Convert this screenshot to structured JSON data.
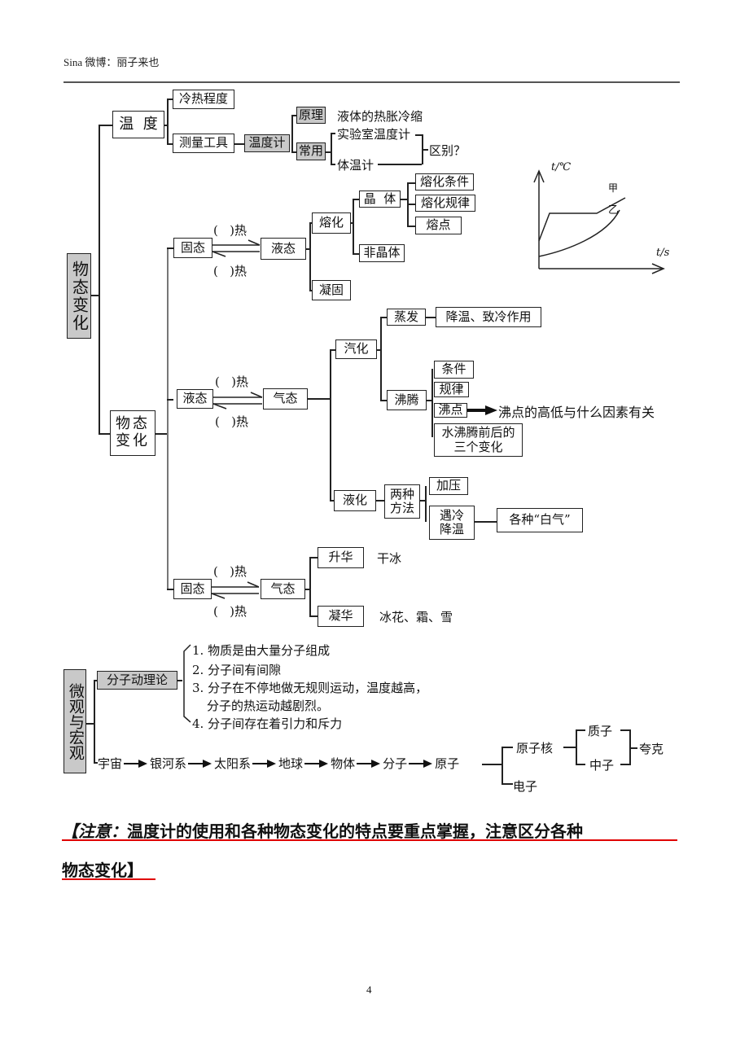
{
  "header": {
    "text": "Sina 微博：丽子来也"
  },
  "root": {
    "wutai_label": "物态变化",
    "weiguan_label": "微观与宏观"
  },
  "temperature": {
    "label": "温  度",
    "meaning": "冷热程度",
    "tool": "测量工具",
    "thermometer": "温度计",
    "principle": "原理",
    "principle_text": "液体的热胀冷缩",
    "common": "常用",
    "lab_thermometer": "实验室温度计",
    "body_thermometer": "体温计",
    "difference": "区别？"
  },
  "graph": {
    "y_label": "t/℃",
    "x_label": "t/s",
    "series": [
      {
        "name": "甲",
        "description": "crystal: rises, plateau, then rises"
      },
      {
        "name": "乙",
        "description": "amorphous: continuously rising curve"
      }
    ]
  },
  "state_change": {
    "label": "物态变化",
    "heat_blank": "(   )热",
    "solid_liquid": {
      "from": "固态",
      "to": "液态",
      "melting": "熔化",
      "crystal": "晶  体",
      "melting_condition": "熔化条件",
      "melting_rule": "熔化规律",
      "melting_point": "熔点",
      "amorphous": "非晶体",
      "solidification": "凝固"
    },
    "liquid_gas": {
      "from": "液态",
      "to": "气态",
      "vaporization": "汽化",
      "evaporation": "蒸发",
      "evaporation_effect": "降温、致冷作用",
      "boiling": "沸腾",
      "boiling_condition": "条件",
      "boiling_rule": "规律",
      "boiling_point": "沸点",
      "boiling_point_question": "沸点的高低与什么因素有关",
      "boiling_changes": "水沸腾前后的三个变化",
      "liquefaction": "液化",
      "two_methods": "两种方法",
      "pressurize": "加压",
      "cooling": "遇冷降温",
      "white_gas": "各种“白气”"
    },
    "solid_gas": {
      "from": "固态",
      "to": "气态",
      "sublimation": "升华",
      "sublimation_example": "干冰",
      "desublimation": "凝华",
      "desublimation_example": "冰花、霜、雪"
    }
  },
  "micro_macro": {
    "label": "微观与宏观",
    "molecular_theory": "分子动理论",
    "points": [
      "1. 物质是由大量分子组成",
      "2. 分子间有间隙",
      "3. 分子在不停地做无规则运动，温度越高，",
      "分子的热运动越剧烈。",
      "4. 分子间存在着引力和斥力"
    ],
    "chain": [
      "宇宙",
      "银河系",
      "太阳系",
      "地球",
      "物体",
      "分子",
      "原子"
    ],
    "nucleus": "原子核",
    "electron": "电子",
    "proton": "质子",
    "neutron": "中子",
    "quark": "夸克"
  },
  "note": {
    "line1_prefix": "【注意：",
    "line1_rest": "温度计的使用和各种物态变化的特点要重点掌握，注意区分各种",
    "line2": "物态变化】"
  },
  "page_number": "4"
}
